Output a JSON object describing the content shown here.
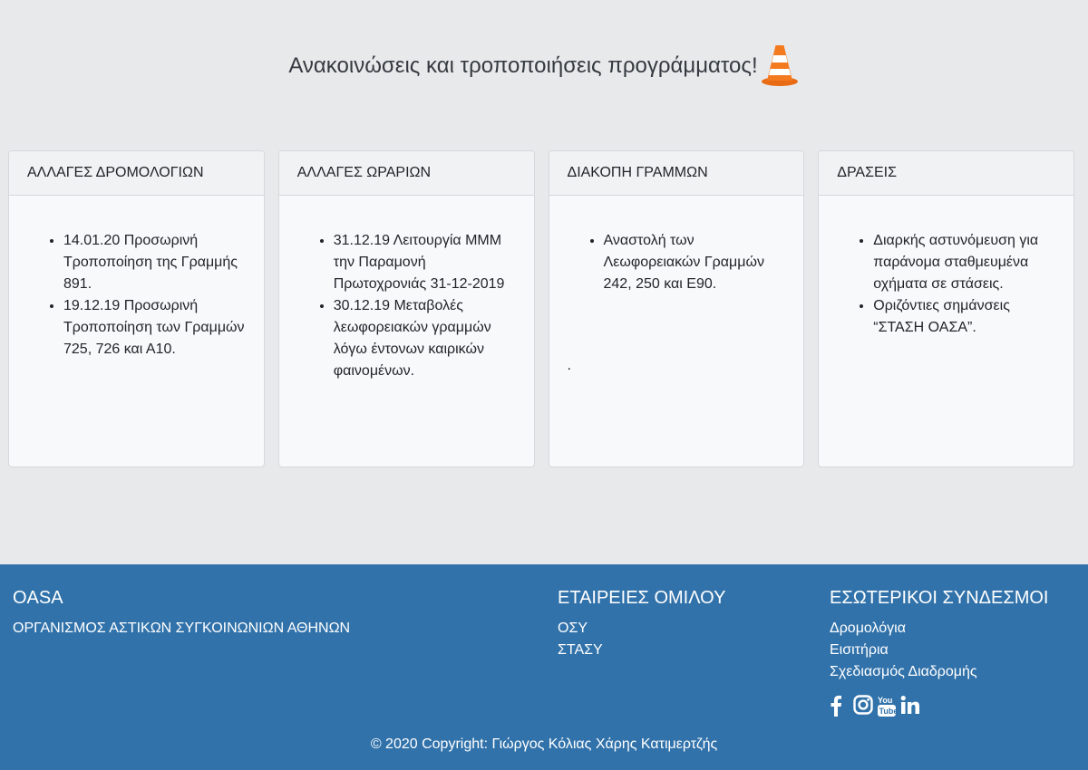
{
  "header": {
    "title": "Ανακοινώσεις και τροποποιήσεις προγράμματος!",
    "icon": "traffic-cone-icon"
  },
  "cards": [
    {
      "title": "ΑΛΛΑΓΕΣ ΔΡΟΜΟΛΟΓΙΩΝ",
      "items": [
        "14.01.20 Προσωρινή Τροποποίηση της Γραμμής 891.",
        "19.12.19 Προσωρινή Τροποποίηση των Γραμμών 725, 726 και Α10."
      ],
      "trailing": ""
    },
    {
      "title": "ΑΛΛΑΓΕΣ ΩΡΑΡΙΩΝ",
      "items": [
        "31.12.19 Λειτουργία ΜΜΜ την Παραμονή Πρωτοχρονιάς 31-12-2019",
        "30.12.19 Μεταβολές λεωφορειακών γραμμών λόγω έντονων καιρικών φαινομένων."
      ],
      "trailing": ""
    },
    {
      "title": "ΔΙΑΚΟΠΗ ΓΡΑΜΜΩΝ",
      "items": [
        "Αναστολή των Λεωφορειακών Γραμμών 242, 250 και Ε90."
      ],
      "trailing": "."
    },
    {
      "title": "ΔΡΑΣΕΙΣ",
      "items": [
        "Διαρκής αστυνόμευση για παράνομα σταθμευμένα οχήματα σε στάσεις.",
        "Οριζόντιες σημάνσεις “ΣΤΑΣΗ ΟΑΣΑ”."
      ],
      "trailing": ""
    }
  ],
  "footer": {
    "col1": {
      "title": "OASA",
      "text": "ΟΡΓΑΝΙΣΜΟΣ ΑΣΤΙΚΩΝ ΣΥΓΚΟΙΝΩΝΙΩΝ ΑΘΗΝΩΝ"
    },
    "col2": {
      "title": "ΕΤΑΙΡΕΙΕΣ ΟΜΙΛΟΥ",
      "links": [
        "ΟΣΥ",
        "ΣΤΑΣΥ"
      ]
    },
    "col3": {
      "title": "ΕΣΩΤΕΡΙΚΟΙ ΣΥΝΔΕΣΜΟΙ",
      "links": [
        "Δρομολόγια",
        "Εισιτήρια",
        "Σχεδιασμός Διαδρομής"
      ]
    },
    "social": [
      "facebook-icon",
      "instagram-icon",
      "youtube-icon",
      "linkedin-icon"
    ],
    "copyright": "© 2020 Copyright: Γιώργος Κόλιας Χάρης Κατιμερτζής"
  },
  "colors": {
    "footer_bg": "#3172aa",
    "page_bg": "#e8e9eb",
    "cone": "#f47a20"
  }
}
